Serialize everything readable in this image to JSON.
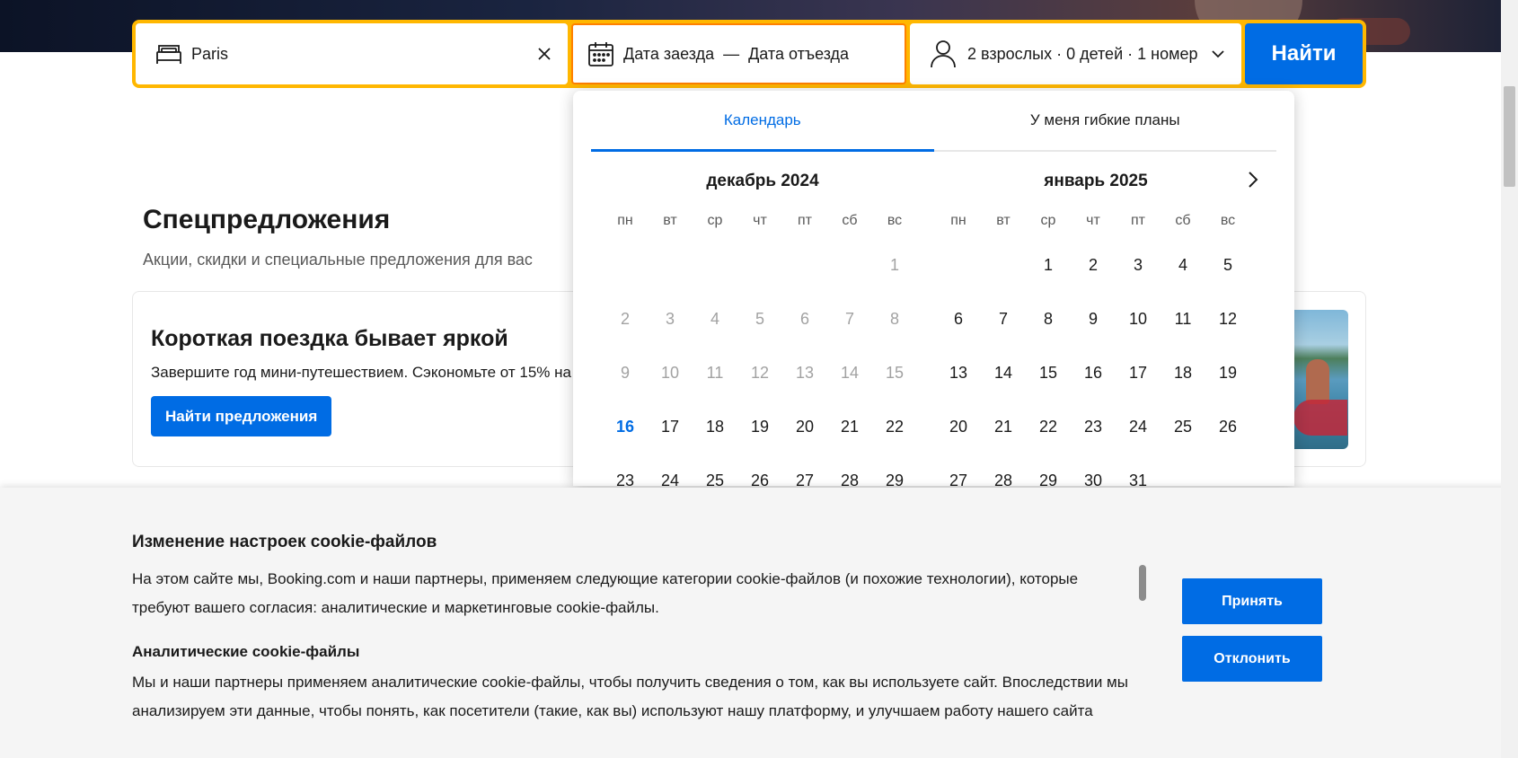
{
  "search": {
    "destination_value": "Paris",
    "checkin_label": "Дата заезда",
    "dash": "—",
    "checkout_label": "Дата отъезда",
    "guests_label": "2 взрослых · 0 детей · 1 номер",
    "submit_label": "Найти"
  },
  "offers": {
    "title": "Спецпредложения",
    "subtitle": "Акции, скидки и специальные предложения для вас",
    "card": {
      "title": "Короткая поездка бывает яркой",
      "description": "Завершите год мини-путешествием. Сэкономьте от 15% на",
      "button_label": "Найти предложения"
    }
  },
  "calendar": {
    "tabs": [
      "Календарь",
      "У меня гибкие планы"
    ],
    "active_tab": 0,
    "weekdays": [
      "пн",
      "вт",
      "ср",
      "чт",
      "пт",
      "сб",
      "вс"
    ],
    "months": [
      {
        "title": "декабрь 2024",
        "leading_blanks": 6,
        "days": [
          "1",
          "2",
          "3",
          "4",
          "5",
          "6",
          "7",
          "8",
          "9",
          "10",
          "11",
          "12",
          "13",
          "14",
          "15",
          "16",
          "17",
          "18",
          "19",
          "20",
          "21",
          "22",
          "23",
          "24",
          "25",
          "26",
          "27",
          "28",
          "29"
        ],
        "past_until": 15,
        "today": 16
      },
      {
        "title": "январь 2025",
        "leading_blanks": 2,
        "days": [
          "1",
          "2",
          "3",
          "4",
          "5",
          "6",
          "7",
          "8",
          "9",
          "10",
          "11",
          "12",
          "13",
          "14",
          "15",
          "16",
          "17",
          "18",
          "19",
          "20",
          "21",
          "22",
          "23",
          "24",
          "25",
          "26",
          "27",
          "28",
          "29",
          "30",
          "31"
        ],
        "past_until": 0,
        "today": null
      }
    ]
  },
  "cookie": {
    "title": "Изменение настроек cookie-файлов",
    "paragraph1": "На этом сайте мы, Booking.com и наши партнеры, применяем следующие категории cookie-файлов (и похожие технологии), которые требуют вашего согласия: аналитические и маркетинговые cookie-файлы.",
    "section_title": "Аналитические cookie-файлы",
    "paragraph2": "Мы и наши партнеры применяем аналитические cookie-файлы, чтобы получить сведения о том, как вы используете сайт. Впоследствии мы анализируем эти данные, чтобы понять, как посетители (такие, как вы) используют нашу платформу, и улучшаем работу нашего сайта",
    "accept_label": "Принять",
    "reject_label": "Отклонить"
  },
  "colors": {
    "brand_blue": "#006ce4",
    "search_border": "#ffb700",
    "active_field_border": "#ff8000"
  },
  "icons": [
    "bed-icon",
    "close-icon",
    "calendar-icon",
    "person-icon",
    "chevron-down-icon",
    "chevron-right-icon"
  ]
}
